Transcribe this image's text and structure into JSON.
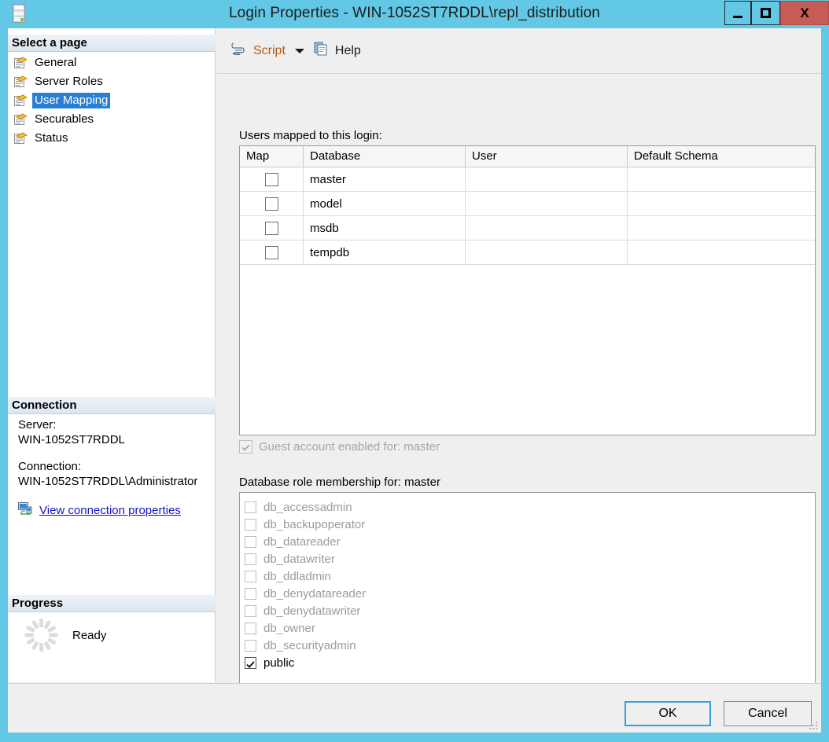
{
  "window": {
    "title": "Login Properties - WIN-1052ST7RDDL\\repl_distribution",
    "icon": "server-icon",
    "frame_color": "#63c7e6",
    "minimize_label": "",
    "maximize_label": "",
    "close_label": "X"
  },
  "sidebar": {
    "select_page_header": "Select a page",
    "pages": [
      {
        "label": "General",
        "selected": false
      },
      {
        "label": "Server Roles",
        "selected": false
      },
      {
        "label": "User Mapping",
        "selected": true
      },
      {
        "label": "Securables",
        "selected": false
      },
      {
        "label": "Status",
        "selected": false
      }
    ],
    "connection_header": "Connection",
    "server_caption": "Server:",
    "server_value": "WIN-1052ST7RDDL",
    "connection_caption": "Connection:",
    "connection_value": "WIN-1052ST7RDDL\\Administrator",
    "view_connection_link": "View connection properties",
    "progress_header": "Progress",
    "progress_status": "Ready"
  },
  "toolbar": {
    "script_label": "Script",
    "help_label": "Help"
  },
  "main": {
    "users_label": "Users mapped to this login:",
    "grid": {
      "columns": [
        "Map",
        "Database",
        "User",
        "Default Schema"
      ],
      "rows": [
        {
          "map": false,
          "database": "master",
          "user": "",
          "schema": ""
        },
        {
          "map": false,
          "database": "model",
          "user": "",
          "schema": ""
        },
        {
          "map": false,
          "database": "msdb",
          "user": "",
          "schema": ""
        },
        {
          "map": false,
          "database": "tempdb",
          "user": "",
          "schema": ""
        }
      ]
    },
    "guest_account": {
      "label": "Guest account enabled for: master",
      "checked": true,
      "disabled": true
    },
    "role_membership_label": "Database role membership for: master",
    "roles": [
      {
        "label": "db_accessadmin",
        "checked": false
      },
      {
        "label": "db_backupoperator",
        "checked": false
      },
      {
        "label": "db_datareader",
        "checked": false
      },
      {
        "label": "db_datawriter",
        "checked": false
      },
      {
        "label": "db_ddladmin",
        "checked": false
      },
      {
        "label": "db_denydatareader",
        "checked": false
      },
      {
        "label": "db_denydatawriter",
        "checked": false
      },
      {
        "label": "db_owner",
        "checked": false
      },
      {
        "label": "db_securityadmin",
        "checked": false
      },
      {
        "label": "public",
        "checked": true
      }
    ]
  },
  "footer": {
    "ok_label": "OK",
    "cancel_label": "Cancel"
  },
  "colors": {
    "title_bar": "#63c7e6",
    "close_button": "#c75b55",
    "selection": "#2a7fd4",
    "link": "#1414cc",
    "focus_border": "#3b9fd6"
  }
}
